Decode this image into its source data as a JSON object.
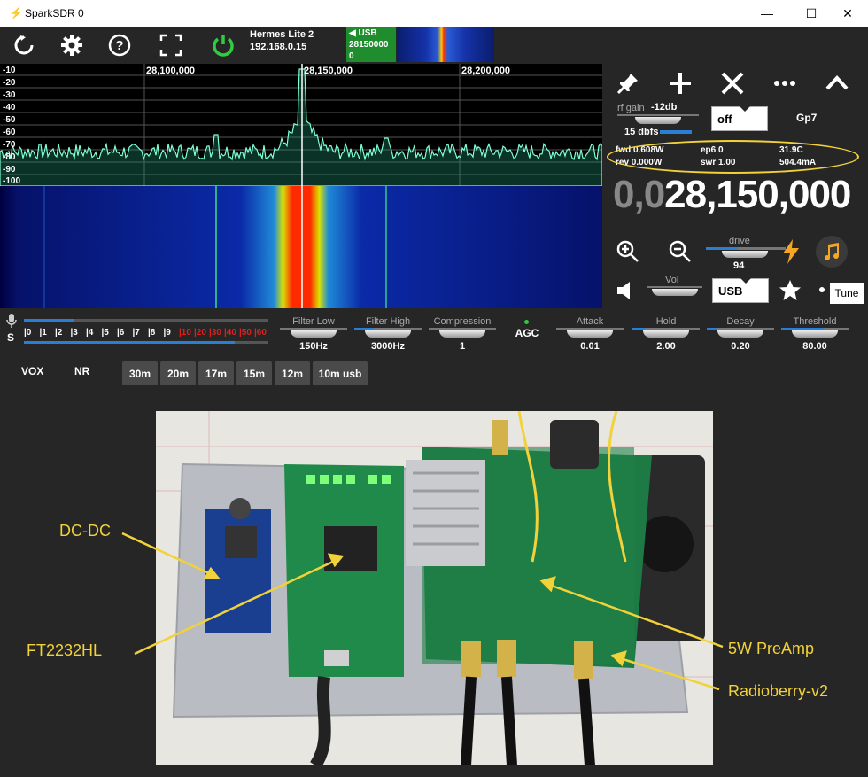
{
  "window": {
    "title": "SparkSDR  0",
    "minimize": "—",
    "maximize": "☐",
    "close": "✕"
  },
  "toolbar": {
    "radio_model": "Hermes Lite 2",
    "radio_ip": "192.168.0.15",
    "mini": {
      "mode": "USB",
      "freq": "28150000",
      "value": "0"
    }
  },
  "spectrum": {
    "db_labels": [
      "-10",
      "-20",
      "-30",
      "-40",
      "-50",
      "-60",
      "-70",
      "-80",
      "-90",
      "-100"
    ],
    "freq_labels": [
      "28,100,000",
      "28,150,000",
      "28,200,000"
    ]
  },
  "right_panel": {
    "rf_gain_label": "rf gain",
    "rf_gain_value": "-12db",
    "dbfs": "15 dbfs",
    "agc_combo": "off",
    "gp": "Gp7",
    "status": {
      "fwd": "fwd 0.608W",
      "rev": "rev 0.000W",
      "ep6": "ep6 0",
      "swr": "swr 1.00",
      "temp": "31.9C",
      "current": "504.4mA"
    },
    "frequency_dim": "0,0",
    "frequency_main": "28,150,000",
    "drive_label": "drive",
    "drive_value": "94",
    "vol_label": "Vol",
    "mode_combo": "USB",
    "tune_label": "Tune"
  },
  "meter": {
    "scale": [
      "|0",
      "|1",
      "|2",
      "|3",
      "|4",
      "|5",
      "|6",
      "|7",
      "|8",
      "|9",
      "|10",
      "|20",
      "|30",
      "|40",
      "|50",
      "|60"
    ],
    "s_label": "S"
  },
  "controls": [
    {
      "label": "Filter Low",
      "value": "150Hz"
    },
    {
      "label": "Filter High",
      "value": "3000Hz"
    },
    {
      "label": "Compression",
      "value": "1"
    },
    {
      "label": "AGC",
      "value": ""
    },
    {
      "label": "Attack",
      "value": "0.01"
    },
    {
      "label": "Hold",
      "value": "2.00"
    },
    {
      "label": "Decay",
      "value": "0.20"
    },
    {
      "label": "Threshold",
      "value": "80.00"
    }
  ],
  "toggles": {
    "vox": "VOX",
    "nr": "NR"
  },
  "bands": [
    "30m",
    "20m",
    "17m",
    "15m",
    "12m",
    "10m usb"
  ],
  "photo_callouts": {
    "dcdc": "DC-DC",
    "ft2232": "FT2232HL",
    "preamp": "5W PreAmp",
    "radioberry": "Radioberry-v2"
  },
  "colors": {
    "accent_green": "#1f8c2e",
    "power_green": "#2ecc40",
    "callout": "#f2d23a",
    "trace": "#7fffd4"
  }
}
